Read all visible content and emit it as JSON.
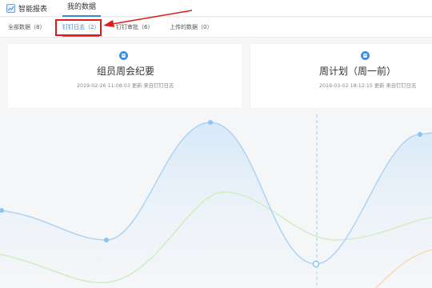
{
  "header": {
    "app_title": "智能报表",
    "tab_my_data": "我的数据"
  },
  "subtabs": [
    {
      "label": "全部数据（8）"
    },
    {
      "label": "钉钉日志（2）"
    },
    {
      "label": "钉钉审批（6）"
    },
    {
      "label": "上传的数据（0）"
    }
  ],
  "cards": [
    {
      "title": "组员周会纪要",
      "meta": "2019-02-26 11:08:03 更新  来自钉钉日志"
    },
    {
      "title": "周计划（周一前）",
      "meta": "2019-03-02 18:12:15 更新  来自钉钉日志"
    }
  ],
  "colors": {
    "accent": "#3a86d7",
    "annotation": "#e01b1b",
    "icon_bg": "#3d8ee0",
    "curve_blue": "#aed3f3",
    "curve_green": "#cfeec2",
    "curve_orange": "#f4dcb5"
  }
}
